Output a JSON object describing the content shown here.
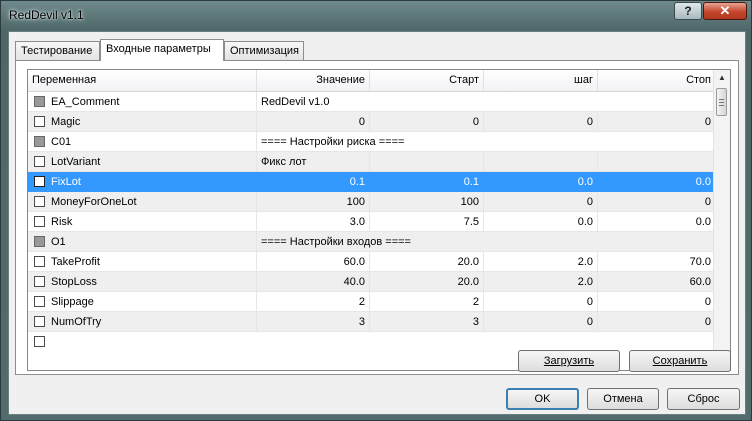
{
  "window": {
    "title": "RedDevil v1.1",
    "help_label": "?",
    "close_label": "✕"
  },
  "tabs": [
    {
      "label": "Тестирование",
      "active": false
    },
    {
      "label": "Входные параметры",
      "active": true
    },
    {
      "label": "Оптимизация",
      "active": false
    }
  ],
  "grid": {
    "columns": [
      "Переменная",
      "Значение",
      "Старт",
      "шаг",
      "Стоп"
    ],
    "rows": [
      {
        "name": "EA_Comment",
        "value": "RedDevil v1.0",
        "start": "",
        "step": "",
        "stop": "",
        "checkbox": "disabled",
        "span": true
      },
      {
        "name": "Magic",
        "value": "0",
        "start": "0",
        "step": "0",
        "stop": "0",
        "checkbox": "enabled"
      },
      {
        "name": "C01",
        "value": "==== Настройки риска ====",
        "start": "",
        "step": "",
        "stop": "",
        "checkbox": "disabled",
        "span": true
      },
      {
        "name": "LotVariant",
        "value": "Фикс лот",
        "start": "",
        "step": "",
        "stop": "",
        "checkbox": "enabled"
      },
      {
        "name": "FixLot",
        "value": "0.1",
        "start": "0.1",
        "step": "0.0",
        "stop": "0.0",
        "checkbox": "enabled",
        "selected": true
      },
      {
        "name": "MoneyForOneLot",
        "value": "100",
        "start": "100",
        "step": "0",
        "stop": "0",
        "checkbox": "enabled"
      },
      {
        "name": "Risk",
        "value": "3.0",
        "start": "7.5",
        "step": "0.0",
        "stop": "0.0",
        "checkbox": "enabled"
      },
      {
        "name": "O1",
        "value": "==== Настройки входов ====",
        "start": "",
        "step": "",
        "stop": "",
        "checkbox": "disabled",
        "span": true
      },
      {
        "name": "TakeProfit",
        "value": "60.0",
        "start": "20.0",
        "step": "2.0",
        "stop": "70.0",
        "checkbox": "enabled"
      },
      {
        "name": "StopLoss",
        "value": "40.0",
        "start": "20.0",
        "step": "2.0",
        "stop": "60.0",
        "checkbox": "enabled"
      },
      {
        "name": "Slippage",
        "value": "2",
        "start": "2",
        "step": "0",
        "stop": "0",
        "checkbox": "enabled"
      },
      {
        "name": "NumOfTry",
        "value": "3",
        "start": "3",
        "step": "0",
        "stop": "0",
        "checkbox": "enabled"
      }
    ]
  },
  "buttons": {
    "load": "Загрузить",
    "save": "Сохранить",
    "ok": "OK",
    "cancel": "Отмена",
    "reset": "Сброс"
  },
  "icons": {
    "scroll_up": "scroll-up-arrow",
    "scroll_down": "scroll-down-arrow"
  }
}
